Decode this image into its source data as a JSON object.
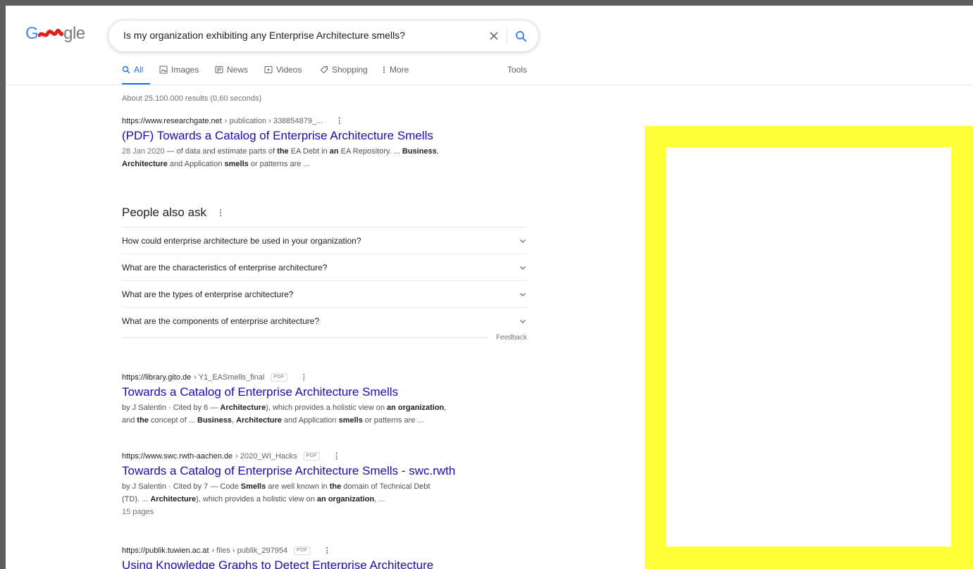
{
  "search": {
    "logo_lead": "G",
    "logo_rest": "gle",
    "query": "Is my organization exhibiting any Enterprise Architecture smells?"
  },
  "tabs": [
    {
      "label": "All",
      "icon": "search-icon",
      "active": true
    },
    {
      "label": "Images",
      "icon": "image-icon",
      "active": false
    },
    {
      "label": "News",
      "icon": "news-icon",
      "active": false
    },
    {
      "label": "Videos",
      "icon": "video-icon",
      "active": false
    },
    {
      "label": "Shopping",
      "icon": "tag-icon",
      "active": false
    },
    {
      "label": "More",
      "icon": "more-icon",
      "active": false
    }
  ],
  "tools_label": "Tools",
  "stats": "About 25.100.000 results (0,60 seconds)",
  "results": [
    {
      "domain": "https://www.researchgate.net",
      "path": " › publication › 338854879_...",
      "title": "(PDF) Towards a Catalog of Enterprise Architecture Smells",
      "date": "28 Jan 2020",
      "snippet_parts": [
        " — of data and estimate parts of ",
        "the",
        " EA Debt in ",
        "an",
        " EA Repository. ... ",
        "Business",
        ","
      ],
      "snippet_line2": [
        "Architecture",
        " and Application ",
        "smells",
        " or patterns are ..."
      ]
    },
    {
      "domain": "https://library.gito.de",
      "path": " › Y1_EASmells_final",
      "badge": "PDF",
      "title": "Towards a Catalog of Enterprise Architecture Smells",
      "line1": [
        "by J Salentin · Cited by 6 — ",
        "Architecture",
        "), which provides a holistic view on ",
        "an organization",
        ","
      ],
      "line2": [
        "and ",
        "the",
        " concept of ... ",
        "Business",
        ", ",
        "Architecture",
        " and Application ",
        "smells",
        " or patterns are ..."
      ]
    },
    {
      "domain": "https://www.swc.rwth-aachen.de",
      "path": " › 2020_WI_Hacks",
      "badge": "PDF",
      "title": "Towards a Catalog of Enterprise Architecture Smells - swc.rwth",
      "line1": [
        "by J Salentin · Cited by 7 — Code ",
        "Smells",
        " are well known in ",
        "the",
        " domain of Technical Debt"
      ],
      "line2": [
        "(TD). ... ",
        "Architecture",
        "), which provides a holistic view on ",
        "an organization",
        ", ..."
      ],
      "line3": "15 pages"
    },
    {
      "domain": "https://publik.tuwien.ac.at",
      "path": " › files › publik_297954",
      "badge": "PDF",
      "title": "Using Knowledge Graphs to Detect Enterprise Architecture"
    }
  ],
  "paa": {
    "title": "People also ask",
    "questions": [
      "How could enterprise architecture be used in your organization?",
      "What are the characteristics of enterprise architecture?",
      "What are the types of enterprise architecture?",
      "What are the components of enterprise architecture?"
    ],
    "feedback": "Feedback"
  },
  "colors": {
    "link": "#1a0dab",
    "accent": "#1a73e8",
    "highlight_frame": "#ffff3a"
  }
}
